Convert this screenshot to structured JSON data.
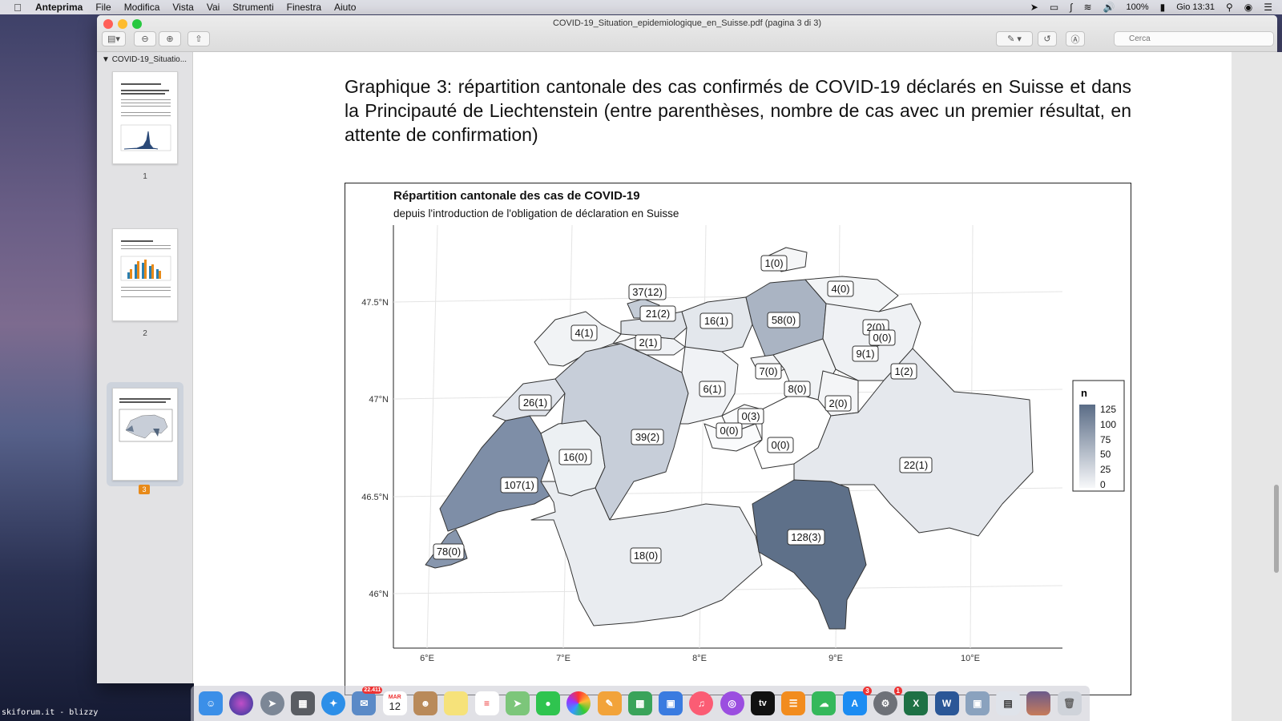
{
  "menubar": {
    "app": "Anteprima",
    "menus": [
      "File",
      "Modifica",
      "Vista",
      "Vai",
      "Strumenti",
      "Finestra",
      "Aiuto"
    ],
    "battery": "100%",
    "clock": "Gio 13:31"
  },
  "window": {
    "title": "COVID-19_Situation_epidemiologique_en_Suisse.pdf (pagina 3 di 3)",
    "search_placeholder": "Cerca"
  },
  "sidebar": {
    "doc_name": "COVID-19_Situatio...",
    "pages": [
      "1",
      "2",
      "3"
    ],
    "selected_page": "3"
  },
  "document": {
    "heading": "Graphique 3: répartition cantonale des cas confirmés de COVID-19 déclarés en Suisse et dans la Principauté de Liechtenstein (entre parenthèses, nombre de cas avec un premier résultat, en attente de confirmation)"
  },
  "map": {
    "title": "Répartition cantonale des cas de COVID-19",
    "subtitle": "depuis l'introduction de l'obligation de déclaration en Suisse",
    "lat_ticks": [
      "47.5°N",
      "47°N",
      "46.5°N",
      "46°N"
    ],
    "lon_ticks": [
      "6°E",
      "7°E",
      "8°E",
      "9°E",
      "10°E"
    ],
    "legend_title": "n",
    "legend_ticks": [
      "125",
      "100",
      "75",
      "50",
      "25",
      "0"
    ],
    "labels": [
      {
        "text": "1(0)",
        "n": 1
      },
      {
        "text": "4(0)",
        "n": 4
      },
      {
        "text": "37(12)",
        "n": 37
      },
      {
        "text": "21(2)",
        "n": 21
      },
      {
        "text": "16(1)",
        "n": 16
      },
      {
        "text": "58(0)",
        "n": 58
      },
      {
        "text": "4(1)",
        "n": 4
      },
      {
        "text": "2(1)",
        "n": 2
      },
      {
        "text": "2(0)",
        "n": 2
      },
      {
        "text": "0(0)",
        "n": 0
      },
      {
        "text": "9(1)",
        "n": 9
      },
      {
        "text": "7(0)",
        "n": 7
      },
      {
        "text": "1(2)",
        "n": 1
      },
      {
        "text": "6(1)",
        "n": 6
      },
      {
        "text": "8(0)",
        "n": 8
      },
      {
        "text": "26(1)",
        "n": 26
      },
      {
        "text": "2(0)",
        "n": 2
      },
      {
        "text": "0(3)",
        "n": 0
      },
      {
        "text": "0(0)",
        "n": 0
      },
      {
        "text": "39(2)",
        "n": 39
      },
      {
        "text": "0(0)",
        "n": 0
      },
      {
        "text": "16(0)",
        "n": 16
      },
      {
        "text": "22(1)",
        "n": 22
      },
      {
        "text": "107(1)",
        "n": 107
      },
      {
        "text": "128(3)",
        "n": 128
      },
      {
        "text": "78(0)",
        "n": 78
      },
      {
        "text": "18(0)",
        "n": 18
      }
    ]
  },
  "dock": {
    "mail_badge": "22.411",
    "calendar_month": "MAR",
    "calendar_day": "12",
    "appstore_badge": "3",
    "prefs_badge": "1",
    "excel_letter": "X",
    "word_letter": "W",
    "tv_label": "tv"
  },
  "watermark": "skiforum.it - blizzy"
}
